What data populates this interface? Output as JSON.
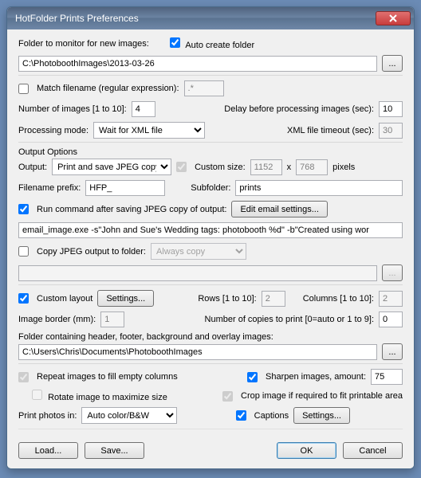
{
  "window": {
    "title": "HotFolder Prints Preferences"
  },
  "folderMonitor": {
    "label": "Folder to monitor for new images:",
    "autoCreate": "Auto create folder",
    "path": "C:\\PhotoboothImages\\2013-03-26",
    "browse": "..."
  },
  "matchFilename": {
    "label": "Match filename (regular expression):",
    "value": ".*"
  },
  "numImages": {
    "label": "Number of images [1 to 10]:",
    "value": "4"
  },
  "delay": {
    "label": "Delay before processing images (sec):",
    "value": "10"
  },
  "processingMode": {
    "label": "Processing mode:",
    "value": "Wait for XML file"
  },
  "xmlTimeout": {
    "label": "XML file timeout (sec):",
    "value": "30"
  },
  "outputGroup": "Output Options",
  "output": {
    "label": "Output:",
    "value": "Print and save JPEG copy"
  },
  "customSize": {
    "label": "Custom size:",
    "w": "1152",
    "x": "x",
    "h": "768",
    "px": "pixels"
  },
  "filenamePrefix": {
    "label": "Filename prefix:",
    "value": "HFP_"
  },
  "subfolder": {
    "label": "Subfolder:",
    "value": "prints"
  },
  "runCmd": {
    "label": "Run command after saving JPEG copy of output:",
    "edit": "Edit email settings...",
    "value": "email_image.exe -s\"John and Sue's Wedding tags: photobooth %d\" -b\"Created using wor"
  },
  "copyJpeg": {
    "label": "Copy JPEG output to folder:",
    "mode": "Always copy",
    "path": "",
    "browse": "..."
  },
  "customLayout": {
    "label": "Custom layout",
    "settings": "Settings..."
  },
  "rows": {
    "label": "Rows [1 to 10]:",
    "value": "2"
  },
  "columns": {
    "label": "Columns [1 to 10]:",
    "value": "2"
  },
  "border": {
    "label": "Image border (mm):",
    "value": "1"
  },
  "copies": {
    "label": "Number of copies to print [0=auto or 1 to 9]:",
    "value": "0"
  },
  "overlayFolder": {
    "label": "Folder containing header, footer, background and overlay images:",
    "path": "C:\\Users\\Chris\\Documents\\PhotoboothImages",
    "browse": "..."
  },
  "repeat": "Repeat images to fill empty columns",
  "sharpen": {
    "label": "Sharpen images, amount:",
    "value": "75"
  },
  "rotate": "Rotate image to maximize size",
  "crop": "Crop image if required to fit printable area",
  "printPhotos": {
    "label": "Print photos in:",
    "value": "Auto color/B&W"
  },
  "captions": {
    "label": "Captions",
    "settings": "Settings..."
  },
  "footer": {
    "load": "Load...",
    "save": "Save...",
    "ok": "OK",
    "cancel": "Cancel"
  }
}
